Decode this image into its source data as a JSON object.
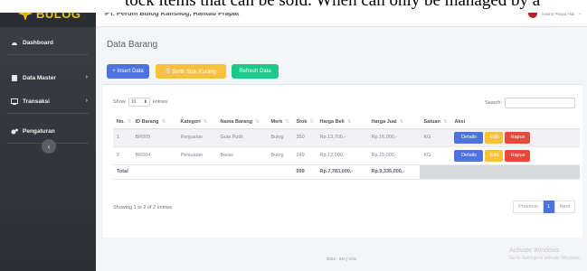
{
  "caption": "tock items that can be sold. When can only be managed by a",
  "brand": {
    "name": "BULOG"
  },
  "sidebar": {
    "items": [
      {
        "label": "Dashboard",
        "icon": "dashboard-icon"
      },
      {
        "label": "Data Master",
        "icon": "database-icon"
      },
      {
        "label": "Transaksi",
        "icon": "monitor-icon"
      },
      {
        "label": "Pengaturan",
        "icon": "gears-icon"
      }
    ],
    "toggle_icon": "chevron-left-icon"
  },
  "topbar": {
    "title": "PT. Perum Bulog Kansilog, Rantau Prapat",
    "user_name": "Anisha Phaya Hidi"
  },
  "page": {
    "title": "Data Barang"
  },
  "toolbar": {
    "insert_label": "+ Insert Data",
    "sortir_label": "☰ Sortir Stok Kurang",
    "refresh_label": "Refresh Data"
  },
  "table_controls": {
    "show_label": "Show",
    "show_value": "10",
    "entries_label": "entries",
    "search_label": "Search:"
  },
  "table": {
    "headers": [
      "No.",
      "ID Barang",
      "Kategori",
      "Nama Barang",
      "Merk",
      "Stok",
      "Harga Beli",
      "Harga Jual",
      "Satuan",
      "Aksi"
    ],
    "rows": [
      {
        "no": "1",
        "id": "BR005",
        "kategori": "Penjualan",
        "nama": "Gula Putih",
        "merk": "Bulog",
        "stok": "350",
        "beli": "Rp.13,700,-",
        "jual": "Rp.16,000,-",
        "satuan": "KG"
      },
      {
        "no": "2",
        "id": "BR004",
        "kategori": "Penjualan",
        "nama": "Beras",
        "merk": "Bulog",
        "stok": "249",
        "beli": "Rp.12,000,-",
        "jual": "Rp.15,000,-",
        "satuan": "KG"
      }
    ],
    "actions": {
      "details": "Details",
      "edit": "Edit",
      "hapus": "Hapus"
    },
    "total": {
      "label": "Total",
      "stok": "599",
      "beli": "Rp.7,783,000,-",
      "jual": "Rp.9,335,000,-"
    }
  },
  "pagination": {
    "info": "Showing 1 to 2 of 2 entries",
    "previous": "Previous",
    "page": "1",
    "next": "Next"
  },
  "footer": {
    "text": "2024 - SIA | V.01"
  },
  "watermark": {
    "title": "Activate Windows",
    "subtitle": "Go to Settings to activate Windows."
  },
  "colors": {
    "primary": "#4e73df",
    "warning": "#f6c23e",
    "success": "#1cc88a",
    "danger": "#e74a3b",
    "brand": "#f2c21b"
  }
}
